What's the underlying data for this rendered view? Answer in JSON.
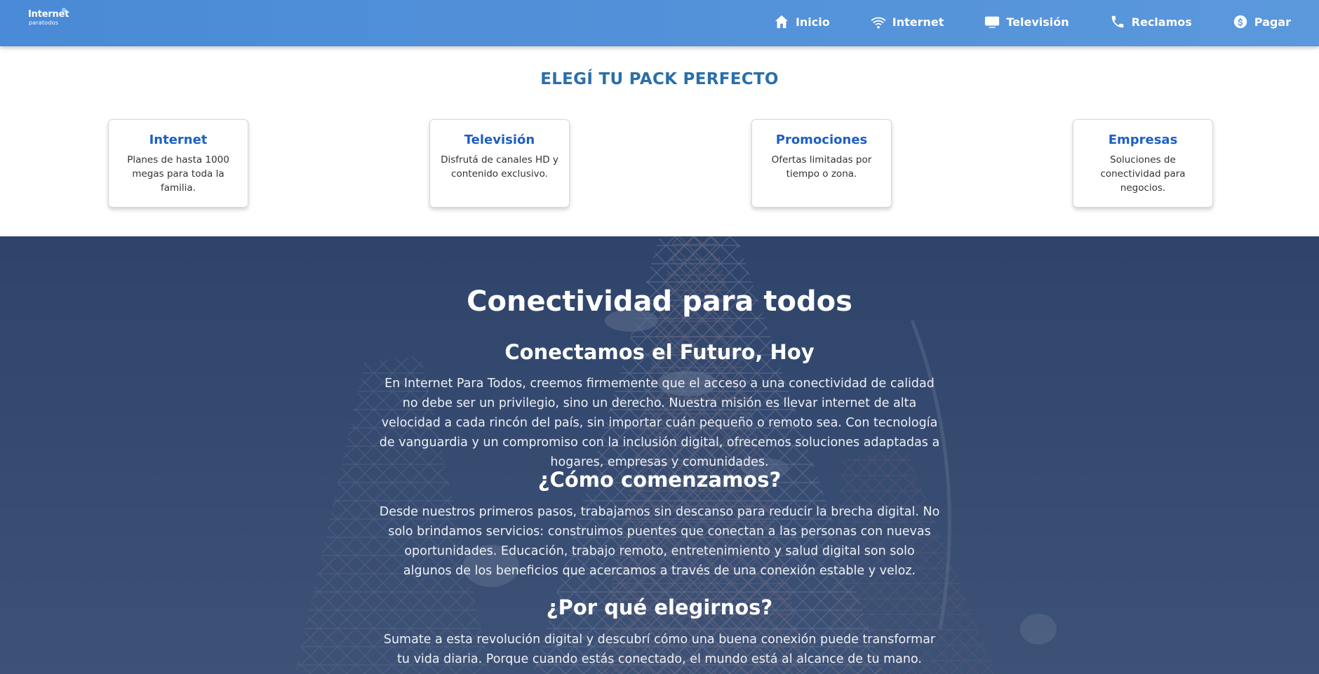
{
  "header": {
    "logo_line1": "Internet",
    "logo_line2": "paratodos",
    "nav": [
      {
        "label": "Inicio",
        "icon": "home-icon"
      },
      {
        "label": "Internet",
        "icon": "wifi-icon"
      },
      {
        "label": "Televisión",
        "icon": "tv-icon"
      },
      {
        "label": "Reclamos",
        "icon": "phone-icon"
      },
      {
        "label": "Pagar",
        "icon": "dollar-coin-icon"
      }
    ]
  },
  "packs": {
    "title": "ELEGÍ TU PACK PERFECTO",
    "cards": [
      {
        "title": "Internet",
        "desc": "Planes de hasta 1000 megas para toda la familia."
      },
      {
        "title": "Televisión",
        "desc": "Disfrutá de canales HD y contenido exclusivo."
      },
      {
        "title": "Promociones",
        "desc": "Ofertas limitadas por tiempo o zona."
      },
      {
        "title": "Empresas",
        "desc": "Soluciones de conectividad para negocios."
      }
    ]
  },
  "hero": {
    "title": "Conectividad para todos",
    "sections": [
      {
        "heading": "Conectamos el Futuro, Hoy",
        "text": "En Internet Para Todos, creemos firmemente que el acceso a una conectividad de calidad no debe ser un privilegio, sino un derecho. Nuestra misión es llevar internet de alta velocidad a cada rincón del país, sin importar cuán pequeño o remoto sea. Con tecnología de vanguardia y un compromiso con la inclusión digital, ofrecemos soluciones adaptadas a hogares, empresas y comunidades."
      },
      {
        "heading": "¿Cómo comenzamos?",
        "text": "Desde nuestros primeros pasos, trabajamos sin descanso para reducir la brecha digital. No solo brindamos servicios: construimos puentes que conectan a las personas con nuevas oportunidades. Educación, trabajo remoto, entretenimiento y salud digital son solo algunos de los beneficios que acercamos a través de una conexión estable y veloz."
      },
      {
        "heading": "¿Por qué elegirnos?",
        "text": "Sumate a esta revolución digital y descubrí cómo una buena conexión puede transformar tu vida diaria. Porque cuando estás conectado, el mundo está al alcance de tu mano."
      }
    ]
  },
  "colors": {
    "header_bg": "#4a8ad6",
    "packs_title": "#2a6fa8",
    "card_title": "#1f5fc2",
    "hero_bg": "#3c4d6e"
  }
}
